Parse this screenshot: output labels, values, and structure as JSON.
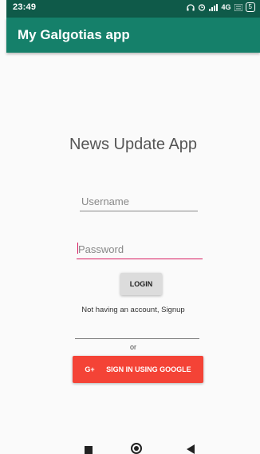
{
  "status_bar": {
    "time": "23:49",
    "network": "4G",
    "battery": "5"
  },
  "app_bar": {
    "title": "My Galgotias app"
  },
  "main": {
    "heading": "News Update App",
    "username_placeholder": "Username",
    "password_placeholder": "Password",
    "login_label": "LOGIN",
    "signup_text": "Not having an account, Signup",
    "or_text": "or",
    "google_prefix": "G+",
    "google_label": "SIGN IN USING GOOGLE"
  },
  "colors": {
    "status_bar": "#0f5a49",
    "app_bar": "#15806a",
    "accent": "#d81b60",
    "google_button": "#f44336"
  }
}
